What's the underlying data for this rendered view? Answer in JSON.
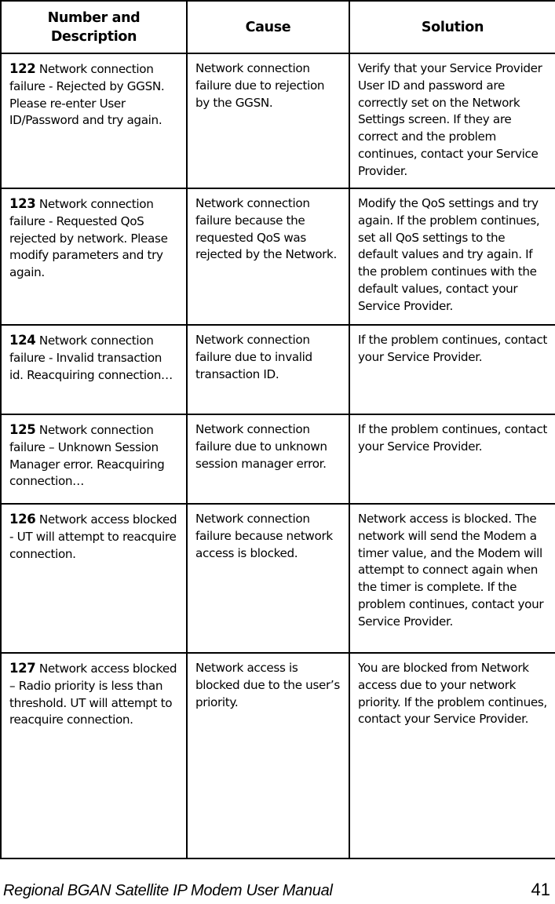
{
  "table": {
    "headers": {
      "number_description": "Number and Description",
      "cause": "Cause",
      "solution": "Solution"
    },
    "rows": [
      {
        "number": "122",
        "description": " Network connection failure - Rejected by GGSN. Please re-enter User ID/Password and try again.",
        "cause": "Network connection failure due to rejection by the GGSN.",
        "solution": "Verify that your Service Provider User ID and password are correctly set on the Network Settings screen. If they are correct and the problem continues, contact your Service Provider."
      },
      {
        "number": "123",
        "description": " Network connection failure - Requested QoS rejected by network. Please modify parameters and try again.",
        "cause": "Network connection failure because the requested QoS was rejected by the Network.",
        "solution": "Modify the QoS settings and try again. If the problem continues, set all QoS settings to the default values and try again. If the problem continues with the default values, contact your Service Provider."
      },
      {
        "number": "124",
        "description": " Network connection failure - Invalid transaction id. Reacquiring connection…",
        "cause": "Network connection failure due to invalid transaction ID.",
        "solution": "If the problem continues, contact your Service Provider."
      },
      {
        "number": "125",
        "description": " Network connection failure – Unknown Session Manager error. Reacquiring connection…",
        "cause": "Network connection failure due to unknown session manager error.",
        "solution": "If the problem continues, contact your Service Provider."
      },
      {
        "number": "126",
        "description": " Network access blocked - UT will attempt to reacquire connection.",
        "cause": "Network connection failure because network access is blocked.",
        "solution": "Network access is blocked. The network will send the Modem a timer value, and the Modem will attempt to connect again when the timer is complete. If the problem continues, contact your Service Provider."
      },
      {
        "number": "127",
        "description": " Network access blocked – Radio priority is less than threshold. UT will attempt to reacquire connection.",
        "cause": "Network access is blocked due to the user’s priority.",
        "solution": "You are blocked from Network access due to your network priority. If the problem continues, contact your Service Provider."
      }
    ]
  },
  "footer": {
    "title": "Regional BGAN Satellite IP Modem User Manual",
    "page_number": "41"
  }
}
